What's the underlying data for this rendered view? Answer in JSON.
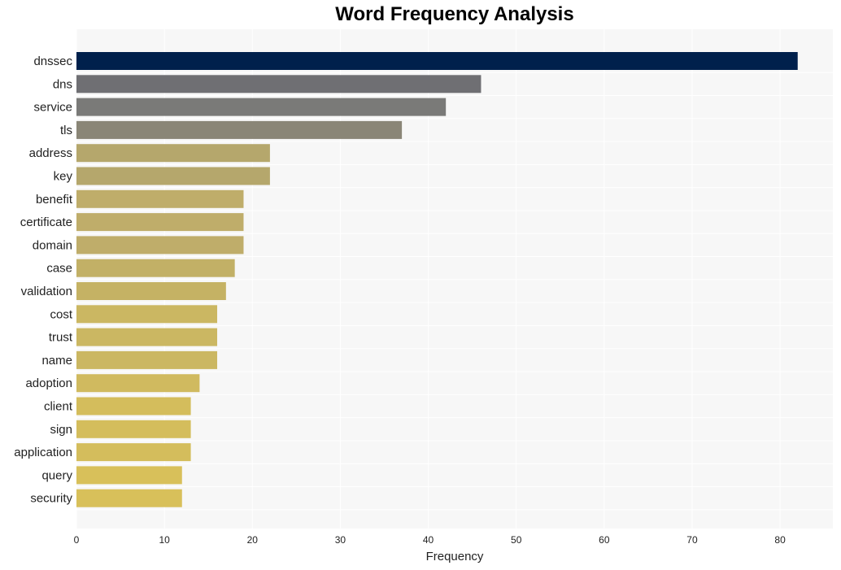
{
  "chart_data": {
    "type": "bar",
    "orientation": "horizontal",
    "title": "Word Frequency Analysis",
    "xlabel": "Frequency",
    "ylabel": "",
    "xlim": [
      0,
      86
    ],
    "xticks": [
      0,
      10,
      20,
      30,
      40,
      50,
      60,
      70,
      80
    ],
    "grid": true,
    "categories": [
      "dnssec",
      "dns",
      "service",
      "tls",
      "address",
      "key",
      "benefit",
      "certificate",
      "domain",
      "case",
      "validation",
      "cost",
      "trust",
      "name",
      "adoption",
      "client",
      "sign",
      "application",
      "query",
      "security"
    ],
    "values": [
      82,
      46,
      42,
      37,
      22,
      22,
      19,
      19,
      19,
      18,
      17,
      16,
      16,
      16,
      14,
      13,
      13,
      13,
      12,
      12
    ],
    "colors": [
      "#00204c",
      "#6f6f73",
      "#7a7a78",
      "#8a8677",
      "#b5a76c",
      "#b5a76c",
      "#bfad6a",
      "#bfad6a",
      "#bfad6a",
      "#c2b066",
      "#c5b264",
      "#cbb762",
      "#cbb762",
      "#cbb762",
      "#d0ba5f",
      "#d4bd5c",
      "#d4bd5c",
      "#d4bd5c",
      "#d8c05a",
      "#d8c05a"
    ]
  }
}
